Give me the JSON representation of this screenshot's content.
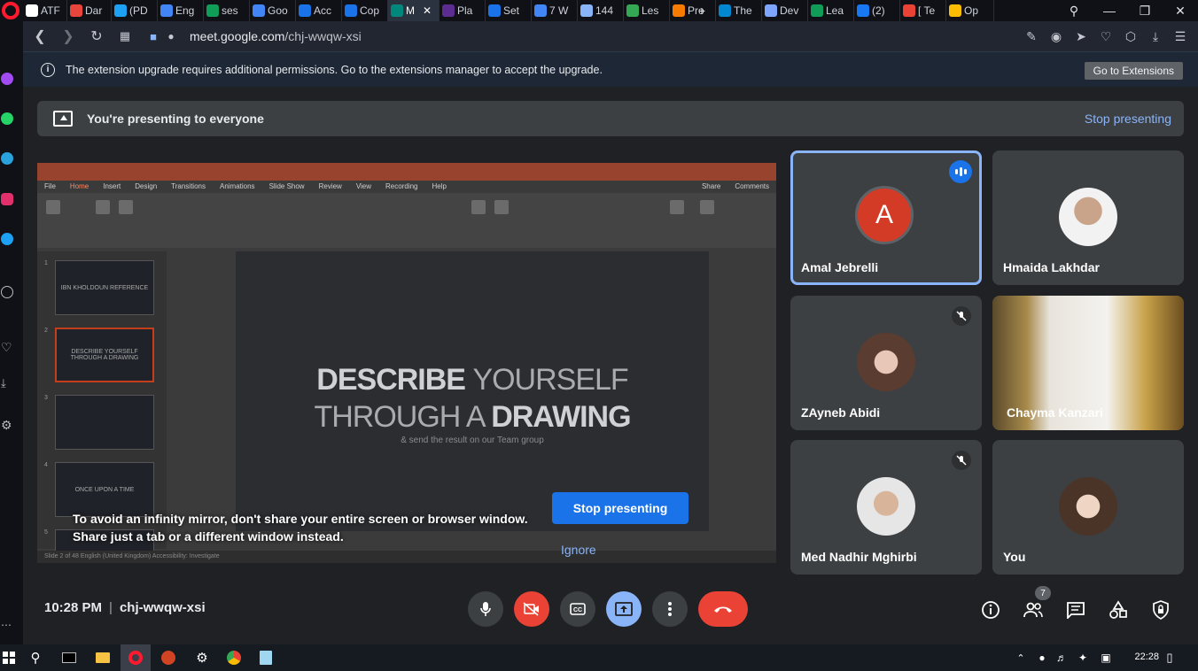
{
  "browser": {
    "tabs": [
      {
        "label": "ATF",
        "color": "#ffffff"
      },
      {
        "label": "Dar",
        "color": "#e8453c"
      },
      {
        "label": "(PD",
        "color": "#1da1f2"
      },
      {
        "label": "Eng",
        "color": "#4285f4"
      },
      {
        "label": "ses",
        "color": "#0f9d58"
      },
      {
        "label": "Goo",
        "color": "#4285f4"
      },
      {
        "label": "Acc",
        "color": "#1a73e8"
      },
      {
        "label": "Cop",
        "color": "#1a73e8"
      },
      {
        "label": "M",
        "color": "#00897b"
      },
      {
        "label": "Pla",
        "color": "#5c2d91"
      },
      {
        "label": "Set",
        "color": "#1a73e8"
      },
      {
        "label": "7 W",
        "color": "#4285f4"
      },
      {
        "label": "144",
        "color": "#8ab4f8"
      },
      {
        "label": "Les",
        "color": "#34a853"
      },
      {
        "label": "Pro",
        "color": "#f57c00"
      },
      {
        "label": "The",
        "color": "#0288d1"
      },
      {
        "label": "Dev",
        "color": "#7ea6ff"
      },
      {
        "label": "Lea",
        "color": "#0f9d58"
      },
      {
        "label": "(2)",
        "color": "#1877f2"
      },
      {
        "label": "[ Te",
        "color": "#ea4335"
      },
      {
        "label": "Op",
        "color": "#fbbc04"
      }
    ],
    "url_domain": "meet.google.com",
    "url_path": "/chj-wwqw-xsi",
    "infobar_text": "The extension upgrade requires additional permissions. Go to the extensions manager to accept the upgrade.",
    "goto_extensions": "Go to Extensions"
  },
  "meet": {
    "banner_text": "You're presenting to everyone",
    "stop_presenting_link": "Stop presenting",
    "overlay_line1": "To avoid an infinity mirror, don't share your entire screen or browser window.",
    "overlay_line2": "Share just a tab or a different window instead.",
    "stop_presenting_button": "Stop presenting",
    "ignore": "Ignore",
    "time": "10:28 PM",
    "meeting_code": "chj-wwqw-xsi",
    "people_count": "7"
  },
  "shared_screen": {
    "menu": [
      "File",
      "Home",
      "Insert",
      "Design",
      "Transitions",
      "Animations",
      "Slide Show",
      "Review",
      "View",
      "Recording",
      "Help"
    ],
    "share_label": "Share",
    "comments_label": "Comments",
    "slide_title_bold1": "DESCRIBE",
    "slide_title_light1": "YOURSELF",
    "slide_title_light2": "THROUGH A",
    "slide_title_bold2": "DRAWING",
    "slide_subtitle": "& send the result on our Team group",
    "thumbs": [
      {
        "num": "1",
        "text": "IBN KHOLDOUN REFERENCE"
      },
      {
        "num": "2",
        "text": "DESCRIBE YOURSELF THROUGH A DRAWING"
      },
      {
        "num": "3",
        "text": ""
      },
      {
        "num": "4",
        "text": "ONCE UPON A TIME"
      },
      {
        "num": "5",
        "text": ""
      }
    ],
    "status_text": "Slide 2 of 48   English (United Kingdom)   Accessibility: Investigate"
  },
  "participants": [
    {
      "name": "Amal Jebrelli",
      "initial": "A",
      "speaking": true,
      "muted": false
    },
    {
      "name": "Hmaida Lakhdar",
      "speaking": false,
      "muted": false
    },
    {
      "name": "ZAyneb Abidi",
      "speaking": false,
      "muted": true
    },
    {
      "name": "Chayma Kanzari",
      "speaking": false,
      "muted": false
    },
    {
      "name": "Med Nadhir Mghirbi",
      "speaking": false,
      "muted": true
    },
    {
      "name": "You",
      "speaking": false,
      "muted": false
    }
  ],
  "taskbar": {
    "clock": "22:28"
  },
  "colors": {
    "accent_blue": "#1a73e8",
    "link_blue": "#8ab4f8",
    "danger_red": "#ea4335",
    "avatar_red": "#d33b27"
  }
}
